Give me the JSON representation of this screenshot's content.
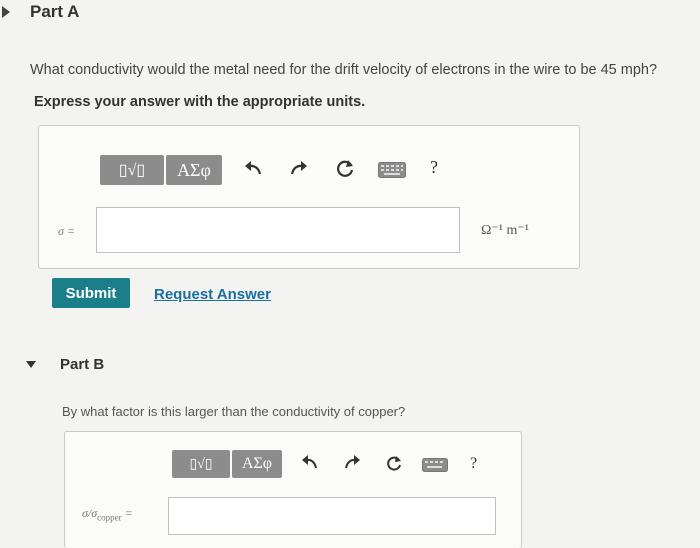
{
  "partA": {
    "title": "Part A",
    "question": "What conductivity would the metal need for the drift velocity of electrons in the wire to be 45 mph?",
    "instruction": "Express your answer with the appropriate units.",
    "symbol_buttons": {
      "matrix": "▯√▯",
      "greek": "ΑΣφ"
    },
    "help": "?",
    "answer_label": "σ =",
    "answer_value": "",
    "units": "Ω⁻¹ m⁻¹",
    "submit_label": "Submit",
    "request_label": "Request Answer"
  },
  "partB": {
    "title": "Part B",
    "question": "By what factor is this larger than the conductivity of copper?",
    "symbol_buttons": {
      "matrix": "▯√▯",
      "greek": "ΑΣφ"
    },
    "help": "?",
    "answer_label": "σ/σ",
    "answer_subscript": "copper",
    "answer_eq": "=",
    "answer_value": ""
  }
}
